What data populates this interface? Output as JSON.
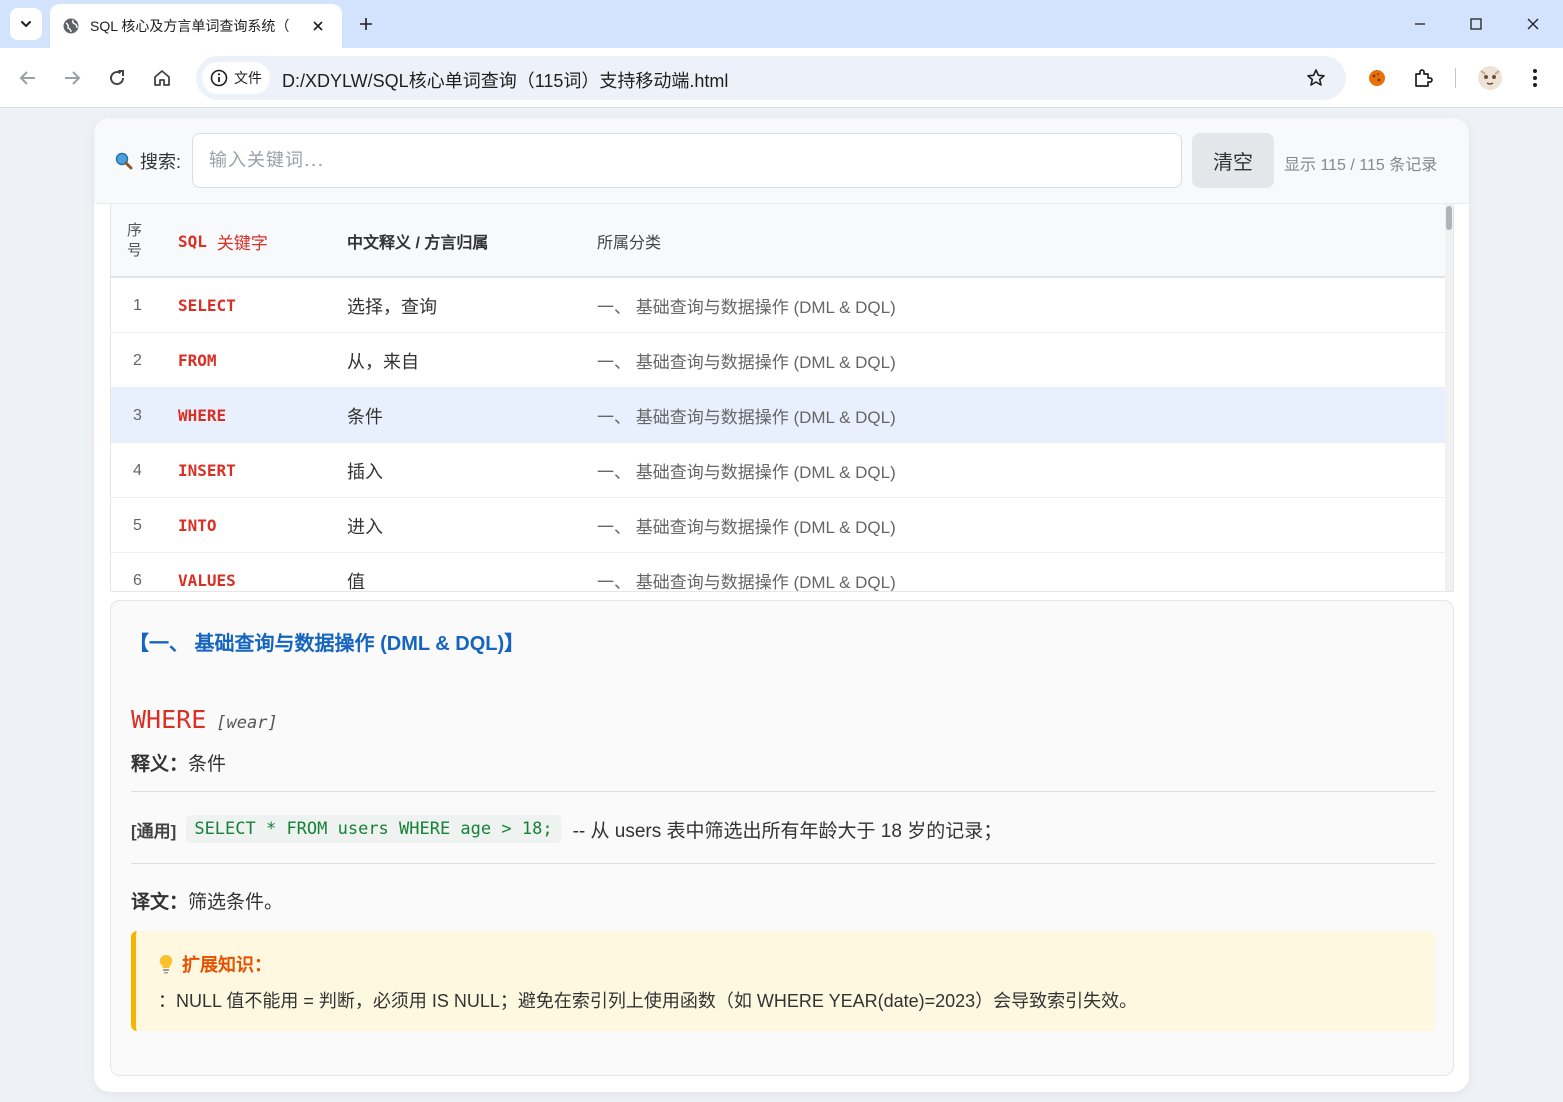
{
  "browser": {
    "tab_title": "SQL 核心及方言单词查询系统（",
    "site_chip": "文件",
    "url": "D:/XDYLW/SQL核心单词查询（115词）支持移动端.html"
  },
  "search": {
    "label": "搜索:",
    "placeholder": "输入关键词...",
    "value": "",
    "clear_label": "清空",
    "count_text": "显示 115 / 115 条记录"
  },
  "table": {
    "headers": {
      "num": "序号",
      "sql": "SQL",
      "sql_cn": "关键字",
      "cn": "中文释义 / 方言归属",
      "cat": "所属分类"
    },
    "rows": [
      {
        "num": "1",
        "kw": "SELECT",
        "cn": "选择，查询",
        "cat": "一、 基础查询与数据操作 (DML & DQL)"
      },
      {
        "num": "2",
        "kw": "FROM",
        "cn": "从，来自",
        "cat": "一、 基础查询与数据操作 (DML & DQL)"
      },
      {
        "num": "3",
        "kw": "WHERE",
        "cn": "条件",
        "cat": "一、 基础查询与数据操作 (DML & DQL)"
      },
      {
        "num": "4",
        "kw": "INSERT",
        "cn": "插入",
        "cat": "一、 基础查询与数据操作 (DML & DQL)"
      },
      {
        "num": "5",
        "kw": "INTO",
        "cn": "进入",
        "cat": "一、 基础查询与数据操作 (DML & DQL)"
      },
      {
        "num": "6",
        "kw": "VALUES",
        "cn": "值",
        "cat": "一、 基础查询与数据操作 (DML & DQL)"
      }
    ],
    "selected_row": 2
  },
  "detail": {
    "category_title": "【一、 基础查询与数据操作 (DML & DQL)】",
    "word": "WHERE",
    "phonetic": "[wear]",
    "def_label": "释义：",
    "def_text": "条件",
    "example_tag": "[通用]",
    "example_code": "SELECT * FROM users WHERE age > 18;",
    "example_comment": "-- 从 users 表中筛选出所有年龄大于 18 岁的记录；",
    "trans_label": "译文：",
    "trans_text": "筛选条件。",
    "ext_title": "扩展知识：",
    "ext_text": "：NULL 值不能用 = 判断，必须用 IS NULL；避免在索引列上使用函数（如 WHERE YEAR(date)=2023）会导致索引失效。"
  },
  "colors": {
    "keyword_red": "#d93025",
    "category_blue": "#1565c0",
    "code_green": "#188038",
    "ext_orange": "#e65100",
    "ext_border": "#f5b400",
    "selected_row": "#e8f0fe"
  }
}
